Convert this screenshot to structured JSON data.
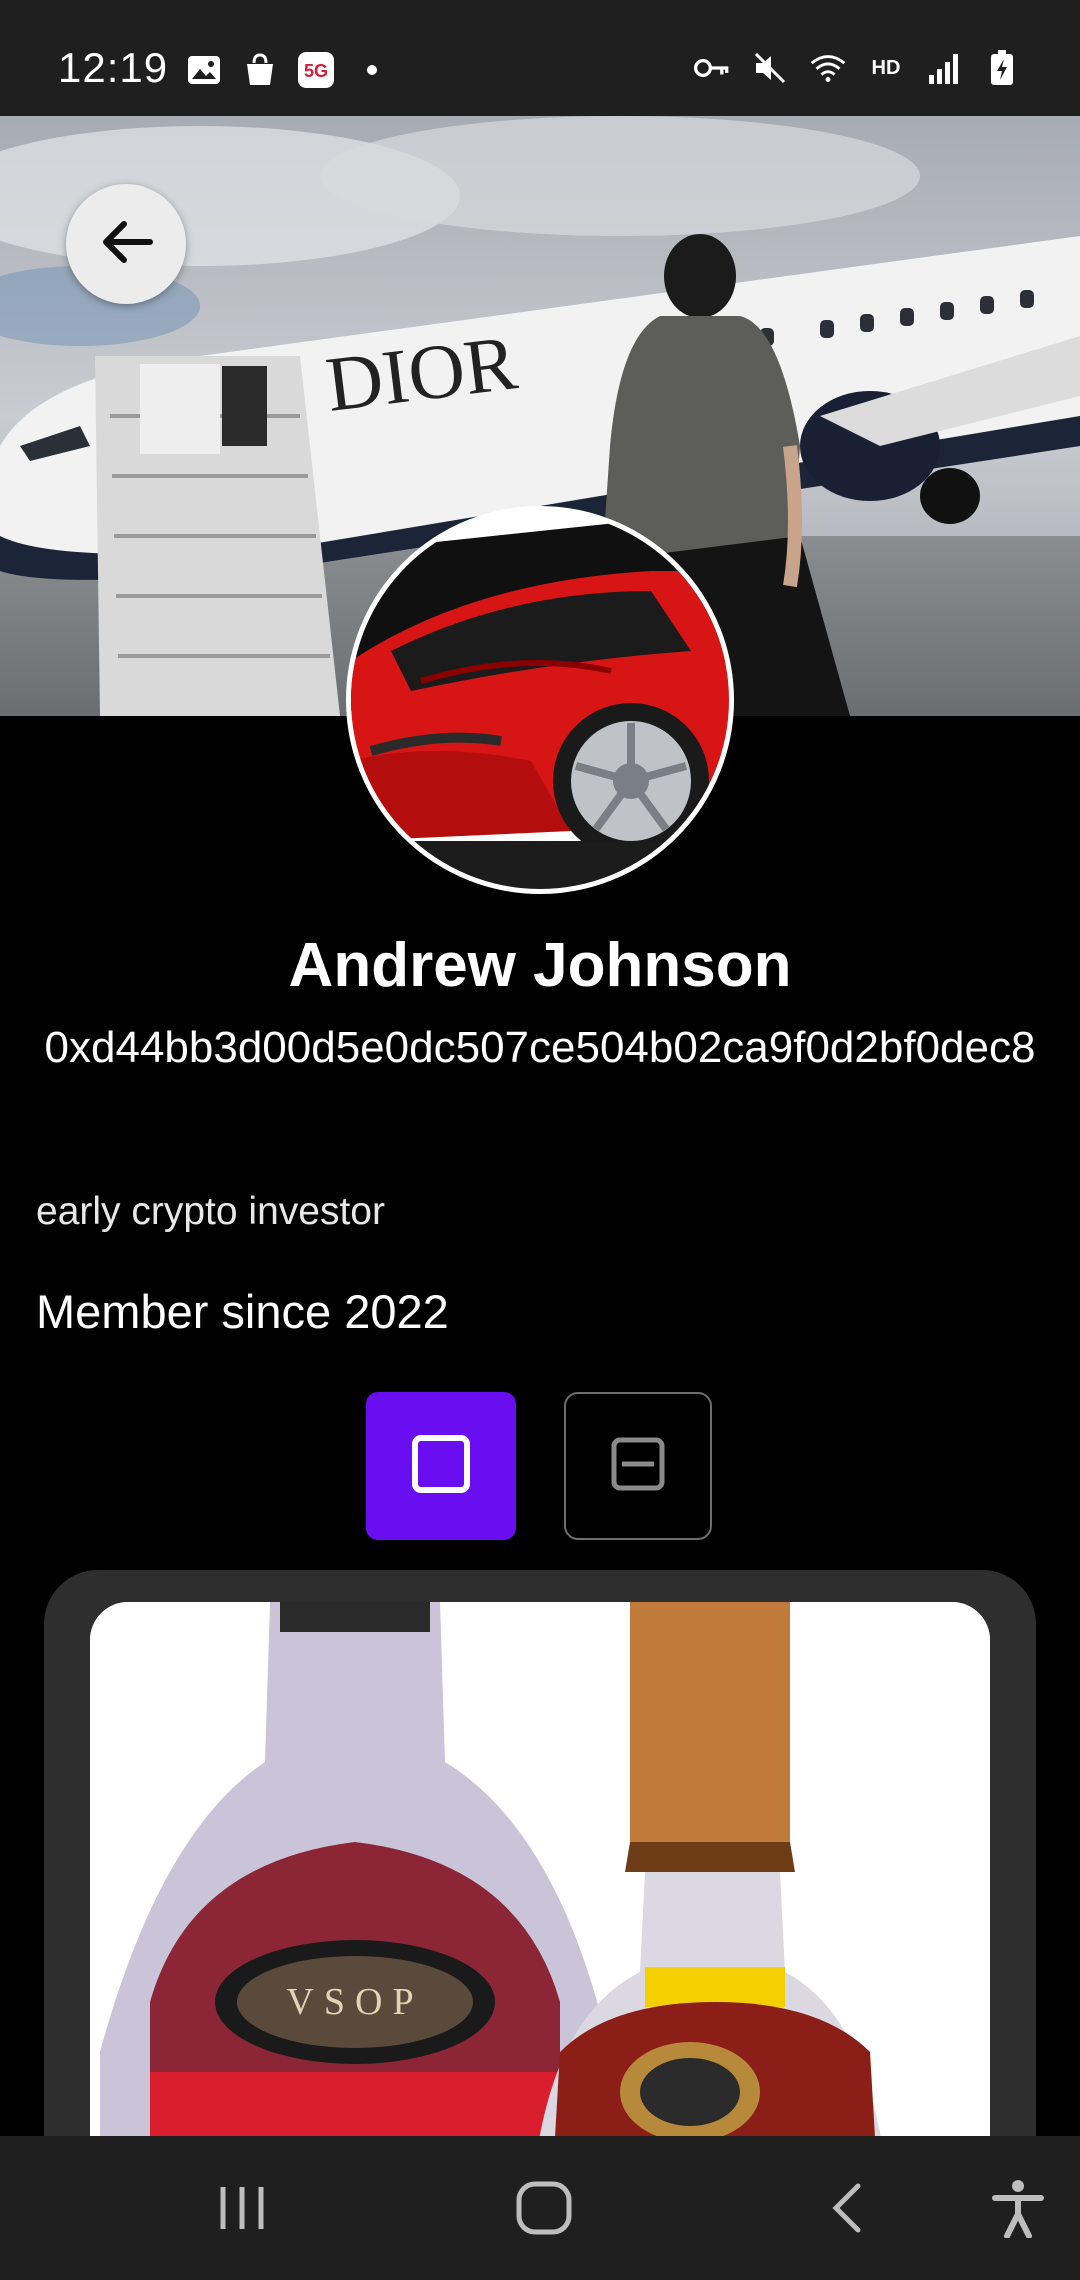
{
  "status_bar": {
    "time": "12:19",
    "left_icons": [
      "gallery-icon",
      "shopping-bag-icon",
      "5g-app-icon",
      "dot-icon"
    ],
    "right_icons": [
      "vpn-key-icon",
      "mute-icon",
      "wifi-icon",
      "hd-icon",
      "signal-icon",
      "battery-charging-icon"
    ],
    "hd_label": "HD"
  },
  "header": {
    "back_icon": "arrow-left-icon"
  },
  "profile": {
    "name": "Andrew Johnson",
    "wallet_address": "0xd44bb3d00d5e0dc507ce504b02ca9f0d2bf0dec8",
    "bio": "early crypto investor",
    "member_since": "Member since 2022"
  },
  "view_toggle": {
    "selected": "single",
    "accent_color": "#6a0ef2"
  },
  "nav_bar": {
    "items": [
      "recent-apps-icon",
      "home-icon",
      "back-icon",
      "accessibility-icon"
    ]
  },
  "colors": {
    "background": "#000000",
    "status_bar": "#1f1f1f",
    "card": "#2e2e2e",
    "accent": "#6a0ef2"
  }
}
